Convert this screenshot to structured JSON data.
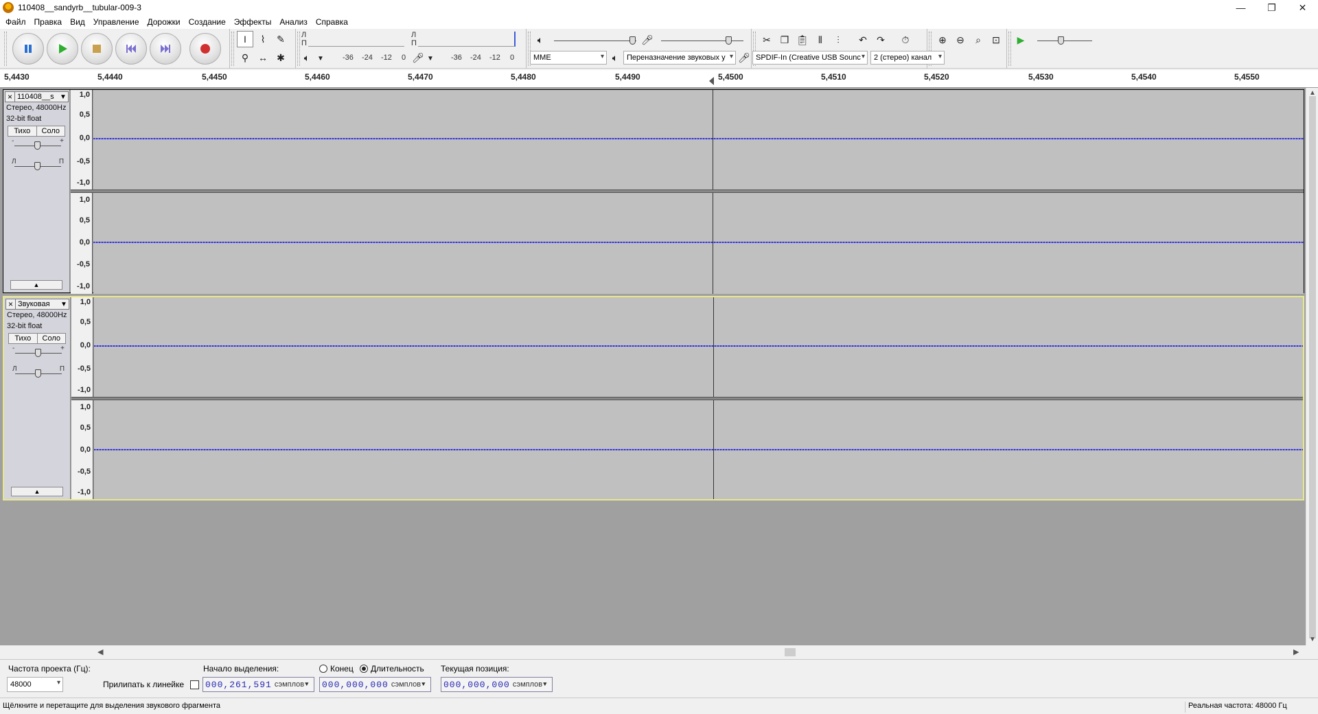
{
  "window": {
    "title": "110408__sandyrb__tubular-009-3",
    "minimize": "—",
    "restore": "❐",
    "close": "✕"
  },
  "menu": [
    "Файл",
    "Правка",
    "Вид",
    "Управление",
    "Дорожки",
    "Создание",
    "Эффекты",
    "Анализ",
    "Справка"
  ],
  "meters": {
    "play_channels": [
      "Л",
      "П"
    ],
    "rec_channels": [
      "Л",
      "П"
    ],
    "play_scale": [
      "-36",
      "-24",
      "-12",
      "0"
    ],
    "rec_scale": [
      "-36",
      "-24",
      "-12",
      "0"
    ],
    "gain_minus": "-",
    "gain_plus": "+"
  },
  "device": {
    "host": "MME",
    "output": "Переназначение звуковых у",
    "input": "SPDIF-In (Creative USB Sounc",
    "channels": "2 (стерео) канал"
  },
  "ruler": {
    "ticks": [
      "5,4430",
      "5,4440",
      "5,4450",
      "5,4460",
      "5,4470",
      "5,4480",
      "5,4490",
      "5,4500",
      "5,4510",
      "5,4520",
      "5,4530",
      "5,4540",
      "5,4550"
    ]
  },
  "vscale": [
    "1,0",
    "0,5",
    "0,0",
    "-0,5",
    "-1,0"
  ],
  "tracks": [
    {
      "name": "110408__s",
      "format": "Стерео, 48000Hz",
      "bits": "32-bit float",
      "mute": "Тихо",
      "solo": "Соло",
      "gain_minus": "-",
      "gain_plus": "+",
      "pan_left": "Л",
      "pan_right": "П",
      "collapse": "▲"
    },
    {
      "name": "Звуковая",
      "format": "Стерео, 48000Hz",
      "bits": "32-bit float",
      "mute": "Тихо",
      "solo": "Соло",
      "gain_minus": "-",
      "gain_plus": "+",
      "pan_left": "Л",
      "pan_right": "П",
      "collapse": "▲"
    }
  ],
  "selection_toolbar": {
    "project_rate_label": "Частота проекта (Гц):",
    "project_rate": "48000",
    "snap_label": "Прилипать к линейке",
    "start_label": "Начало выделения:",
    "start_value": "000,261,591",
    "end_label": "Конец",
    "length_label": "Длительность",
    "length_value": "000,000,000",
    "position_label": "Текущая позиция:",
    "position_value": "000,000,000",
    "unit": "сэмплов"
  },
  "status": {
    "hint": "Щёлкните и перетащите для выделения звукового фрагмента",
    "rate": "Реальная частота: 48000 Гц"
  }
}
